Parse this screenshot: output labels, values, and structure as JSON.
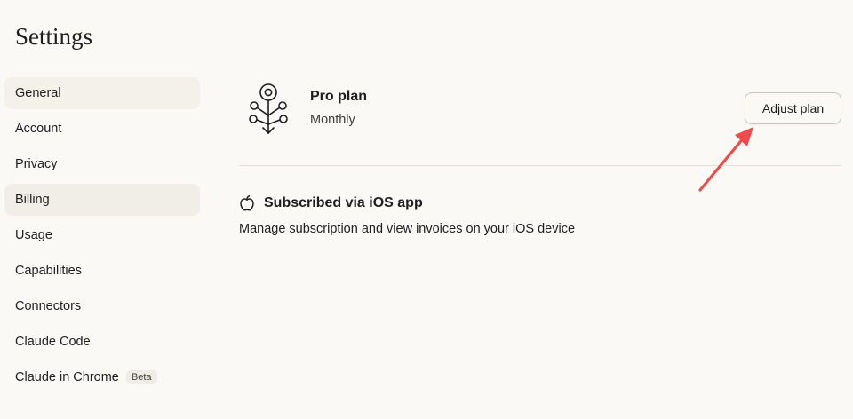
{
  "page": {
    "title": "Settings"
  },
  "sidebar": {
    "items": [
      {
        "label": "General"
      },
      {
        "label": "Account"
      },
      {
        "label": "Privacy"
      },
      {
        "label": "Billing"
      },
      {
        "label": "Usage"
      },
      {
        "label": "Capabilities"
      },
      {
        "label": "Connectors"
      },
      {
        "label": "Claude Code"
      },
      {
        "label": "Claude in Chrome",
        "badge": "Beta"
      }
    ],
    "active": "Billing"
  },
  "plan": {
    "name": "Pro plan",
    "period": "Monthly",
    "adjust_label": "Adjust plan",
    "icon": "plan-tree-icon"
  },
  "subscription": {
    "icon": "apple-icon",
    "title": "Subscribed via iOS app",
    "description": "Manage subscription and view invoices on your iOS device"
  },
  "colors": {
    "background": "#faf9f5",
    "active_nav": "#f0eee6",
    "text": "#1f1e1d",
    "annotation_arrow": "#ef4b4b"
  }
}
